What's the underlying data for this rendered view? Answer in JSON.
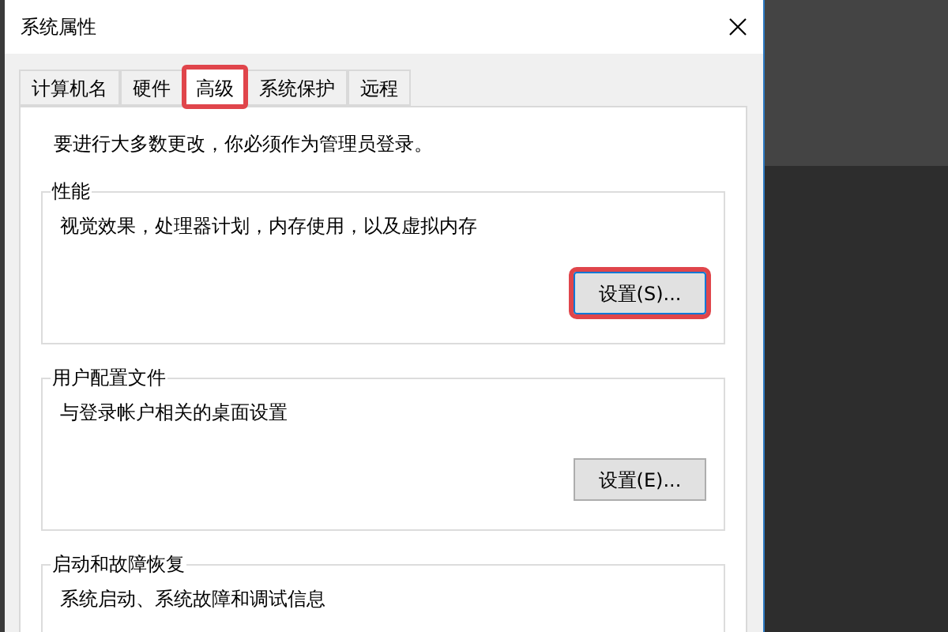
{
  "window": {
    "title": "系统属性"
  },
  "tabs": [
    {
      "label": "计算机名",
      "selected": false,
      "highlighted": false
    },
    {
      "label": "硬件",
      "selected": false,
      "highlighted": false
    },
    {
      "label": "高级",
      "selected": true,
      "highlighted": true
    },
    {
      "label": "系统保护",
      "selected": false,
      "highlighted": false
    },
    {
      "label": "远程",
      "selected": false,
      "highlighted": false
    }
  ],
  "notice": "要进行大多数更改，你必须作为管理员登录。",
  "groups": [
    {
      "title": "性能",
      "description": "视觉效果，处理器计划，内存使用，以及虚拟内存",
      "button": {
        "label": "设置(S)...",
        "focused": true,
        "highlighted": true
      }
    },
    {
      "title": "用户配置文件",
      "description": "与登录帐户相关的桌面设置",
      "button": {
        "label": "设置(E)...",
        "focused": false,
        "highlighted": false
      }
    },
    {
      "title": "启动和故障恢复",
      "description": "系统启动、系统故障和调试信息"
    }
  ]
}
